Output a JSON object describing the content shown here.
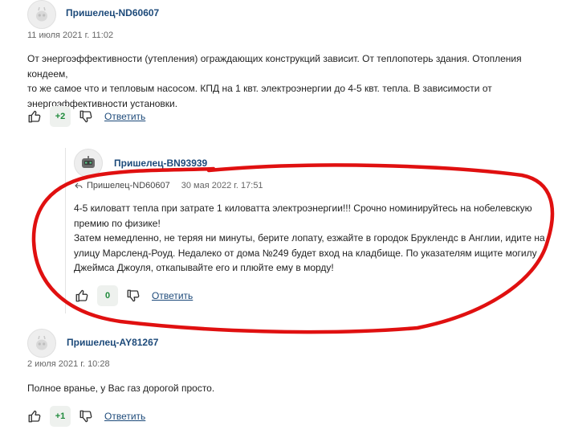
{
  "comments": [
    {
      "author": "Пришелец-ND60607",
      "date": "11 июля 2021 г. 11:02",
      "lines": [
        "От энергоэффективности (утепления) ограждающих конструкций зависит. От теплопотерь здания. Отопления кондеем,",
        "то же самое что и тепловым насосом. КПД на 1 квт. электроэнергии до 4-5 квт. тепла. В зависимости от",
        "энергоэффективности установки."
      ],
      "score": "+2",
      "reply_label": "Ответить"
    },
    {
      "author": "Пришелец-BN93939",
      "reply_to": "Пришелец-ND60607",
      "date": "30 мая 2022 г. 17:51",
      "lines": [
        "4-5 киловатт тепла при затрате 1 киловатта электроэнергии!!! Срочно номинируйтесь на нобелевскую",
        "премию по физике!",
        "Затем немедленно, не теряя ни минуты, берите лопату, езжайте в городок Бруклендс в Англии, идите на",
        "улицу Марсленд-Роуд. Недалеко от дома №249 будет вход на кладбище. По указателям ищите могилу",
        "Джеймса Джоуля, откапывайте его и плюйте ему в морду!"
      ],
      "score": "0",
      "reply_label": "Ответить"
    },
    {
      "author": "Пришелец-AY81267",
      "date": "2 июля 2021 г. 10:28",
      "lines": [
        "Полное вранье, у Вас газ дорогой просто."
      ],
      "score": "+1",
      "reply_label": "Ответить"
    }
  ],
  "colors": {
    "link": "#1d4a7a",
    "positive": "#1f8a3b",
    "annotation": "#e01010"
  },
  "icons": [
    "avatar-alien-icon",
    "thumbs-up-icon",
    "thumbs-down-icon",
    "reply-arrow-icon"
  ]
}
